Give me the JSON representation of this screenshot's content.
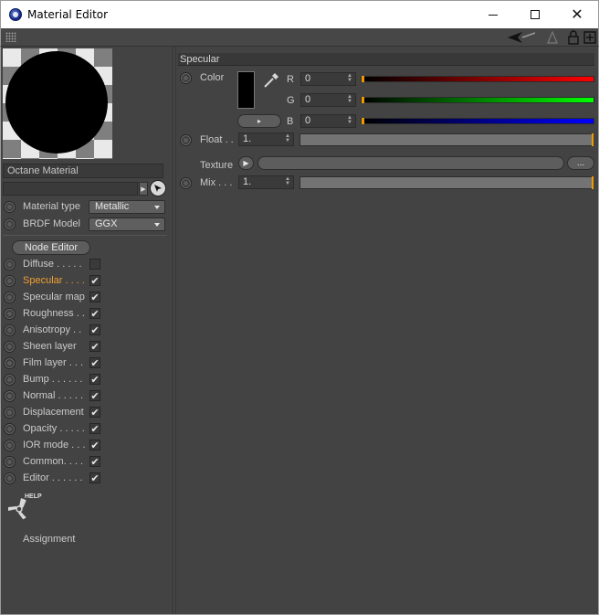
{
  "window": {
    "title": "Material Editor"
  },
  "left": {
    "material_name": "Octane Material",
    "material_type": {
      "label": "Material type",
      "value": "Metallic"
    },
    "brdf_model": {
      "label": "BRDF Model",
      "value": "GGX"
    },
    "node_editor_label": "Node Editor",
    "channels": [
      {
        "label": "Diffuse . . . . .",
        "checked": false,
        "active": false
      },
      {
        "label": "Specular . . . .",
        "checked": true,
        "active": true
      },
      {
        "label": "Specular map",
        "checked": true,
        "active": false
      },
      {
        "label": "Roughness . .",
        "checked": true,
        "active": false
      },
      {
        "label": "Anisotropy . .",
        "checked": true,
        "active": false
      },
      {
        "label": "Sheen layer",
        "checked": true,
        "active": false
      },
      {
        "label": "Film layer . . .",
        "checked": true,
        "active": false
      },
      {
        "label": "Bump . . . . . .",
        "checked": true,
        "active": false
      },
      {
        "label": "Normal . . . . .",
        "checked": true,
        "active": false
      },
      {
        "label": "Displacement",
        "checked": true,
        "active": false
      },
      {
        "label": "Opacity . . . . .",
        "checked": true,
        "active": false
      },
      {
        "label": "IOR mode . . .",
        "checked": true,
        "active": false
      },
      {
        "label": "Common. . . .",
        "checked": true,
        "active": false
      },
      {
        "label": "Editor . . . . . .",
        "checked": true,
        "active": false
      }
    ],
    "help_label": "HELP",
    "assignment_label": "Assignment"
  },
  "right": {
    "section_title": "Specular",
    "color": {
      "label": "Color",
      "r": {
        "label": "R",
        "value": "0"
      },
      "g": {
        "label": "G",
        "value": "0"
      },
      "b": {
        "label": "B",
        "value": "0"
      },
      "expand_glyph": "▸"
    },
    "float": {
      "label": "Float . .",
      "value": "1."
    },
    "texture": {
      "label": "Texture",
      "more_label": "..."
    },
    "mix": {
      "label": "Mix . . .",
      "value": "1."
    }
  },
  "colors": {
    "accent": "#f09a00",
    "panel": "#434343"
  }
}
